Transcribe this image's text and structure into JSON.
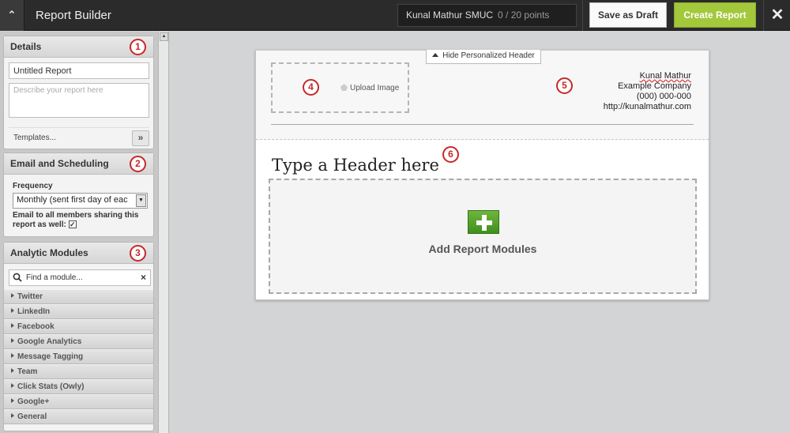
{
  "topbar": {
    "collapse_icon": "chevron-up-icon",
    "title": "Report Builder",
    "account_name": "Kunal Mathur SMUC",
    "points": "0 /  20 points",
    "save_draft_label": "Save as Draft",
    "create_label": "Create Report",
    "close_icon": "close-icon",
    "accent_color": "#a3c83b"
  },
  "sidebar": {
    "details": {
      "title": "Details",
      "callout": "1",
      "report_name_value": "Untitled Report",
      "description_placeholder": "Describe your report here",
      "templates_label": "Templates...",
      "templates_button": "»"
    },
    "email": {
      "title": "Email and Scheduling",
      "callout": "2",
      "frequency_label": "Frequency",
      "frequency_value": "Monthly (sent first day of eac",
      "share_note": "Email to all members sharing this report as well:",
      "share_checked": "✓"
    },
    "modules": {
      "title": "Analytic Modules",
      "callout": "3",
      "search_value": "Find a module...",
      "clear": "×",
      "items": [
        {
          "label": "Twitter"
        },
        {
          "label": "LinkedIn"
        },
        {
          "label": "Facebook"
        },
        {
          "label": "Google Analytics"
        },
        {
          "label": "Message Tagging"
        },
        {
          "label": "Team"
        },
        {
          "label": "Click Stats (Owly)"
        },
        {
          "label": "Google+"
        },
        {
          "label": "General"
        }
      ]
    }
  },
  "report": {
    "hide_header_label": "Hide Personalized Header",
    "upload_label": "Upload Image",
    "callout_4": "4",
    "callout_5": "5",
    "callout_6": "6",
    "contact": {
      "name": "Kunal Mathur",
      "company": "Example Company",
      "phone": "(000) 000-000",
      "url": "http://kunalmathur.com"
    },
    "heading": "Type a Header here",
    "add_modules_label": "Add Report Modules"
  }
}
